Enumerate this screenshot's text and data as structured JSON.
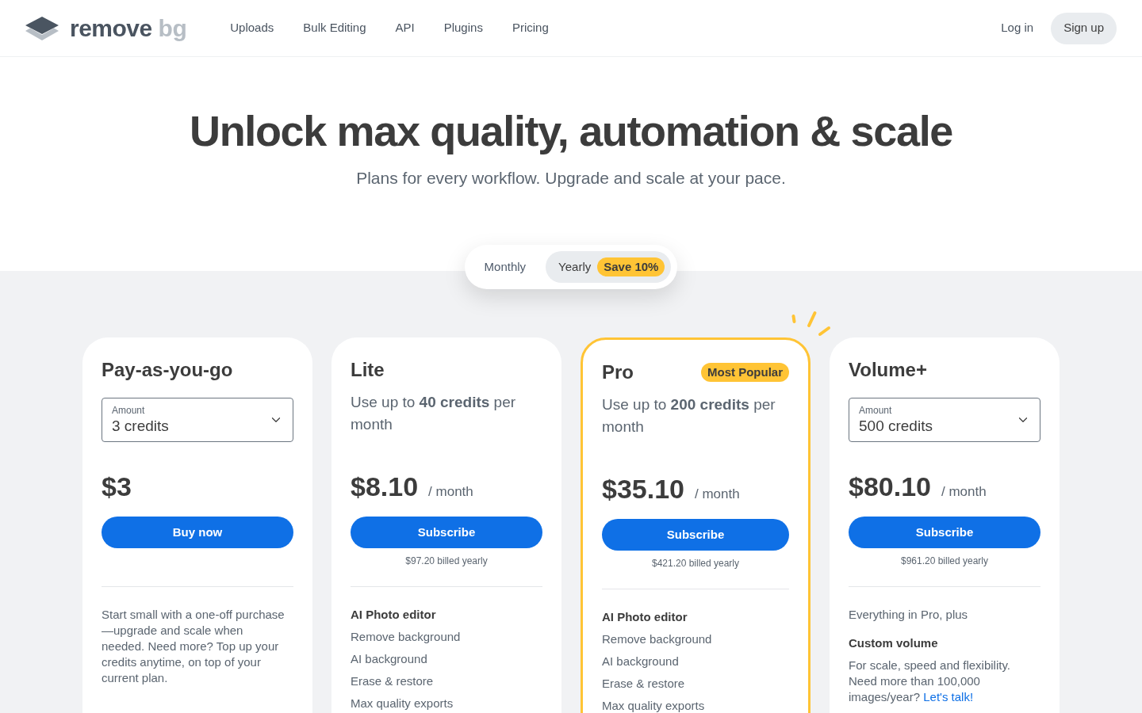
{
  "header": {
    "logo": {
      "primary": "remove",
      "secondary": "bg"
    },
    "nav": [
      "Uploads",
      "Bulk Editing",
      "API",
      "Plugins",
      "Pricing"
    ],
    "login": "Log in",
    "signup": "Sign up"
  },
  "hero": {
    "title": "Unlock max quality, automation & scale",
    "subtitle": "Plans for every workflow. Upgrade and scale at your pace."
  },
  "billing_toggle": {
    "options": [
      {
        "label": "Monthly",
        "selected": false
      },
      {
        "label": "Yearly",
        "selected": true,
        "badge": "Save 10%"
      }
    ]
  },
  "plans": [
    {
      "name": "Pay-as-you-go",
      "highlighted": false,
      "amount_select": {
        "label": "Amount",
        "value": "3 credits"
      },
      "price": "$3",
      "button": "Buy now",
      "description": "Start small with a one-off purchase—upgrade and scale when needed. Need more? Top up your credits anytime, on top of your current plan."
    },
    {
      "name": "Lite",
      "highlighted": false,
      "summary": "Use up to **40 credits** per month",
      "price": "$8.10",
      "period": "/ month",
      "button": "Subscribe",
      "billed": "$97.20 billed yearly",
      "features": {
        "heading": "AI Photo editor",
        "items": [
          "Remove background",
          "AI background",
          "Erase & restore",
          "Max quality exports"
        ]
      }
    },
    {
      "name": "Pro",
      "highlighted": true,
      "badge": "Most Popular",
      "summary": "Use up to **200 credits** per month",
      "price": "$35.10",
      "period": "/ month",
      "button": "Subscribe",
      "billed": "$421.20 billed yearly",
      "features": {
        "heading": "AI Photo editor",
        "items": [
          "Remove background",
          "AI background",
          "Erase & restore",
          "Max quality exports"
        ]
      }
    },
    {
      "name": "Volume+",
      "highlighted": false,
      "amount_select": {
        "label": "Amount",
        "value": "500 credits"
      },
      "price": "$80.10",
      "period": "/ month",
      "button": "Subscribe",
      "billed": "$961.20 billed yearly",
      "includes": "Everything in Pro, plus",
      "custom": {
        "heading": "Custom volume",
        "text": "For scale, speed and flexibility. Need more than 100,000 images/year?",
        "link": "Let's talk!"
      }
    }
  ]
}
